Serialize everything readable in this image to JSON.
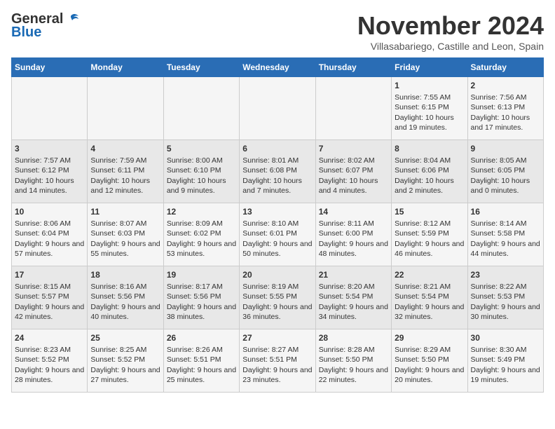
{
  "header": {
    "logo_general": "General",
    "logo_blue": "Blue",
    "month_title": "November 2024",
    "subtitle": "Villasabariego, Castille and Leon, Spain"
  },
  "days_of_week": [
    "Sunday",
    "Monday",
    "Tuesday",
    "Wednesday",
    "Thursday",
    "Friday",
    "Saturday"
  ],
  "weeks": [
    [
      {
        "day": "",
        "info": ""
      },
      {
        "day": "",
        "info": ""
      },
      {
        "day": "",
        "info": ""
      },
      {
        "day": "",
        "info": ""
      },
      {
        "day": "",
        "info": ""
      },
      {
        "day": "1",
        "info": "Sunrise: 7:55 AM\nSunset: 6:15 PM\nDaylight: 10 hours and 19 minutes."
      },
      {
        "day": "2",
        "info": "Sunrise: 7:56 AM\nSunset: 6:13 PM\nDaylight: 10 hours and 17 minutes."
      }
    ],
    [
      {
        "day": "3",
        "info": "Sunrise: 7:57 AM\nSunset: 6:12 PM\nDaylight: 10 hours and 14 minutes."
      },
      {
        "day": "4",
        "info": "Sunrise: 7:59 AM\nSunset: 6:11 PM\nDaylight: 10 hours and 12 minutes."
      },
      {
        "day": "5",
        "info": "Sunrise: 8:00 AM\nSunset: 6:10 PM\nDaylight: 10 hours and 9 minutes."
      },
      {
        "day": "6",
        "info": "Sunrise: 8:01 AM\nSunset: 6:08 PM\nDaylight: 10 hours and 7 minutes."
      },
      {
        "day": "7",
        "info": "Sunrise: 8:02 AM\nSunset: 6:07 PM\nDaylight: 10 hours and 4 minutes."
      },
      {
        "day": "8",
        "info": "Sunrise: 8:04 AM\nSunset: 6:06 PM\nDaylight: 10 hours and 2 minutes."
      },
      {
        "day": "9",
        "info": "Sunrise: 8:05 AM\nSunset: 6:05 PM\nDaylight: 10 hours and 0 minutes."
      }
    ],
    [
      {
        "day": "10",
        "info": "Sunrise: 8:06 AM\nSunset: 6:04 PM\nDaylight: 9 hours and 57 minutes."
      },
      {
        "day": "11",
        "info": "Sunrise: 8:07 AM\nSunset: 6:03 PM\nDaylight: 9 hours and 55 minutes."
      },
      {
        "day": "12",
        "info": "Sunrise: 8:09 AM\nSunset: 6:02 PM\nDaylight: 9 hours and 53 minutes."
      },
      {
        "day": "13",
        "info": "Sunrise: 8:10 AM\nSunset: 6:01 PM\nDaylight: 9 hours and 50 minutes."
      },
      {
        "day": "14",
        "info": "Sunrise: 8:11 AM\nSunset: 6:00 PM\nDaylight: 9 hours and 48 minutes."
      },
      {
        "day": "15",
        "info": "Sunrise: 8:12 AM\nSunset: 5:59 PM\nDaylight: 9 hours and 46 minutes."
      },
      {
        "day": "16",
        "info": "Sunrise: 8:14 AM\nSunset: 5:58 PM\nDaylight: 9 hours and 44 minutes."
      }
    ],
    [
      {
        "day": "17",
        "info": "Sunrise: 8:15 AM\nSunset: 5:57 PM\nDaylight: 9 hours and 42 minutes."
      },
      {
        "day": "18",
        "info": "Sunrise: 8:16 AM\nSunset: 5:56 PM\nDaylight: 9 hours and 40 minutes."
      },
      {
        "day": "19",
        "info": "Sunrise: 8:17 AM\nSunset: 5:56 PM\nDaylight: 9 hours and 38 minutes."
      },
      {
        "day": "20",
        "info": "Sunrise: 8:19 AM\nSunset: 5:55 PM\nDaylight: 9 hours and 36 minutes."
      },
      {
        "day": "21",
        "info": "Sunrise: 8:20 AM\nSunset: 5:54 PM\nDaylight: 9 hours and 34 minutes."
      },
      {
        "day": "22",
        "info": "Sunrise: 8:21 AM\nSunset: 5:54 PM\nDaylight: 9 hours and 32 minutes."
      },
      {
        "day": "23",
        "info": "Sunrise: 8:22 AM\nSunset: 5:53 PM\nDaylight: 9 hours and 30 minutes."
      }
    ],
    [
      {
        "day": "24",
        "info": "Sunrise: 8:23 AM\nSunset: 5:52 PM\nDaylight: 9 hours and 28 minutes."
      },
      {
        "day": "25",
        "info": "Sunrise: 8:25 AM\nSunset: 5:52 PM\nDaylight: 9 hours and 27 minutes."
      },
      {
        "day": "26",
        "info": "Sunrise: 8:26 AM\nSunset: 5:51 PM\nDaylight: 9 hours and 25 minutes."
      },
      {
        "day": "27",
        "info": "Sunrise: 8:27 AM\nSunset: 5:51 PM\nDaylight: 9 hours and 23 minutes."
      },
      {
        "day": "28",
        "info": "Sunrise: 8:28 AM\nSunset: 5:50 PM\nDaylight: 9 hours and 22 minutes."
      },
      {
        "day": "29",
        "info": "Sunrise: 8:29 AM\nSunset: 5:50 PM\nDaylight: 9 hours and 20 minutes."
      },
      {
        "day": "30",
        "info": "Sunrise: 8:30 AM\nSunset: 5:49 PM\nDaylight: 9 hours and 19 minutes."
      }
    ]
  ]
}
